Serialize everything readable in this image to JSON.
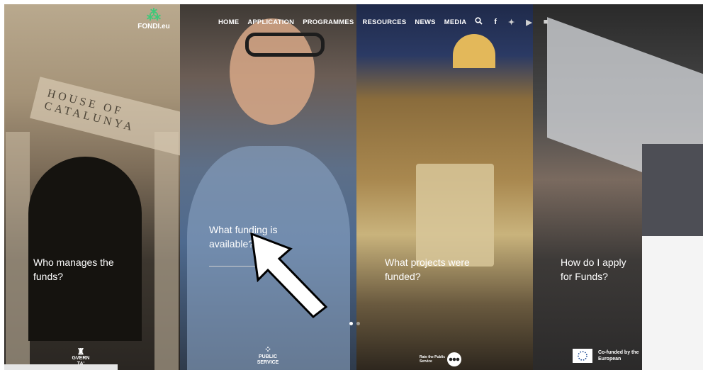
{
  "header": {
    "logo_text": "FONDI.eu",
    "nav": [
      "HOME",
      "APPLICATION",
      "PROGRAMMES",
      "RESOURCES",
      "NEWS",
      "MEDIA"
    ],
    "icons": [
      "search-icon",
      "facebook-icon",
      "twitter-icon",
      "youtube-icon",
      "linkedin-icon"
    ]
  },
  "panels": [
    {
      "caption": "Who manages the funds?",
      "sign_text": "HOUSE OF CATALUNYA",
      "footer_text": "GVERN TA' MALTA"
    },
    {
      "caption": "What funding is available?",
      "footer_text": "PUBLIC SERVICE"
    },
    {
      "caption": "What projects were funded?",
      "footer_text": "Rate the Public Service"
    },
    {
      "caption": "How do I apply for Funds?",
      "footer_text": "Co-funded by the European"
    }
  ],
  "carousel": {
    "active_index": 0,
    "count": 2
  },
  "colors": {
    "logo_accent": "#3ec97a",
    "text": "#ffffff"
  }
}
